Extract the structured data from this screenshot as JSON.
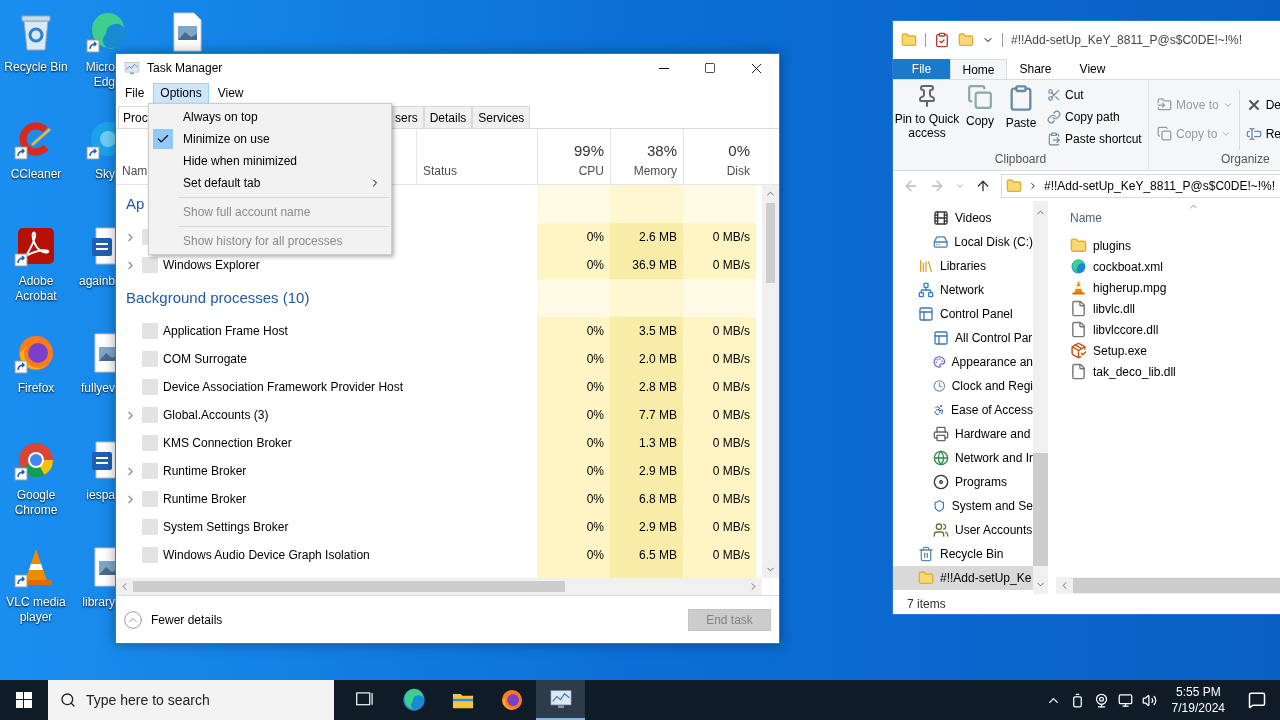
{
  "desktop": {
    "columns": [
      [
        {
          "kind": "recycle",
          "label": "Recycle Bin",
          "shortcut": false
        },
        {
          "kind": "ccleaner",
          "label": "CCleaner",
          "shortcut": true
        },
        {
          "kind": "acrobat",
          "label": "Adobe Acrobat",
          "shortcut": true
        },
        {
          "kind": "firefox",
          "label": "Firefox",
          "shortcut": true
        },
        {
          "kind": "chrome",
          "label": "Google Chrome",
          "shortcut": true
        },
        {
          "kind": "vlc",
          "label": "VLC media player",
          "shortcut": true
        }
      ],
      [
        {
          "kind": "edge",
          "label": "Micro Edg",
          "shortcut": true
        },
        {
          "kind": "skype",
          "label": "Sky",
          "shortcut": true
        },
        {
          "kind": "word",
          "label": "againb",
          "shortcut": false
        },
        {
          "kind": "image",
          "label": "fullyev",
          "shortcut": false
        },
        {
          "kind": "word",
          "label": "iespa",
          "shortcut": false
        },
        {
          "kind": "image",
          "label": "library",
          "shortcut": false
        }
      ],
      [
        {
          "kind": "image",
          "shortcut": false
        }
      ]
    ]
  },
  "task_manager": {
    "title": "Task Manager",
    "menus": [
      {
        "label": "File",
        "selected": false
      },
      {
        "label": "Options",
        "selected": true
      },
      {
        "label": "View",
        "selected": false
      }
    ],
    "options_menu": [
      {
        "kind": "item",
        "label": "Always on top",
        "checked": false,
        "disabled": false
      },
      {
        "kind": "item",
        "label": "Minimize on use",
        "checked": true,
        "disabled": false
      },
      {
        "kind": "item",
        "label": "Hide when minimized",
        "checked": false,
        "disabled": false
      },
      {
        "kind": "submenu",
        "label": "Set default tab",
        "checked": false,
        "disabled": false
      },
      {
        "kind": "separator"
      },
      {
        "kind": "item",
        "label": "Show full account name",
        "checked": false,
        "disabled": true
      },
      {
        "kind": "separator"
      },
      {
        "kind": "item",
        "label": "Show history for all processes",
        "checked": false,
        "disabled": true
      }
    ],
    "tabs": [
      {
        "label": "Proc",
        "selected": true
      },
      {
        "label": "sers",
        "selected": false
      },
      {
        "label": "Details",
        "selected": false
      },
      {
        "label": "Services",
        "selected": false
      }
    ],
    "columns": {
      "name": "Nam",
      "status": "Status",
      "cpu": {
        "percent": "99%",
        "label": "CPU"
      },
      "memory": {
        "percent": "38%",
        "label": "Memory"
      },
      "disk": {
        "percent": "0%",
        "label": "Disk"
      }
    },
    "sections": [
      {
        "title": "Ap",
        "rows": [
          {
            "expandable": true,
            "cpu": "0%",
            "memory": "2.6 MB",
            "disk": "0 MB/s"
          },
          {
            "name": "Windows Explorer",
            "expandable": true,
            "cpu": "0%",
            "memory": "36.9 MB",
            "disk": "0 MB/s"
          }
        ]
      },
      {
        "title": "Background processes (10)",
        "rows": [
          {
            "name": "Application Frame Host",
            "expandable": false,
            "cpu": "0%",
            "memory": "3.5 MB",
            "disk": "0 MB/s"
          },
          {
            "name": "COM Surrogate",
            "expandable": false,
            "cpu": "0%",
            "memory": "2.0 MB",
            "disk": "0 MB/s"
          },
          {
            "name": "Device Association Framework Provider Host",
            "expandable": false,
            "cpu": "0%",
            "memory": "2.8 MB",
            "disk": "0 MB/s"
          },
          {
            "name": "Global.Accounts (3)",
            "expandable": true,
            "cpu": "0%",
            "memory": "7.7 MB",
            "disk": "0 MB/s"
          },
          {
            "name": "KMS Connection Broker",
            "expandable": false,
            "cpu": "0%",
            "memory": "1.3 MB",
            "disk": "0 MB/s"
          },
          {
            "name": "Runtime Broker",
            "expandable": true,
            "cpu": "0%",
            "memory": "2.9 MB",
            "disk": "0 MB/s"
          },
          {
            "name": "Runtime Broker",
            "expandable": true,
            "cpu": "0%",
            "memory": "6.8 MB",
            "disk": "0 MB/s"
          },
          {
            "name": "System Settings Broker",
            "expandable": false,
            "cpu": "0%",
            "memory": "2.9 MB",
            "disk": "0 MB/s"
          },
          {
            "name": "Windows Audio Device Graph Isolation",
            "expandable": false,
            "cpu": "0%",
            "memory": "6.5 MB",
            "disk": "0 MB/s"
          }
        ]
      }
    ],
    "footer": {
      "toggle": "Fewer details",
      "end_task": {
        "label": "End task",
        "disabled": true
      }
    }
  },
  "explorer": {
    "title": "#!!Add-setUp_KeY_8811_P@s$C0DE!~!%!",
    "ribbon_tabs": [
      {
        "label": "File",
        "kind": "file",
        "selected": false
      },
      {
        "label": "Home",
        "kind": "tab",
        "selected": true
      },
      {
        "label": "Share",
        "kind": "tab",
        "selected": false
      },
      {
        "label": "View",
        "kind": "tab",
        "selected": false
      }
    ],
    "clipboard": {
      "pin": "Pin to Quick access",
      "copy": "Copy",
      "paste": "Paste",
      "cut": "Cut",
      "copy_path": "Copy path",
      "paste_shortcut": "Paste shortcut",
      "label": "Clipboard"
    },
    "organize": {
      "move_to": {
        "label": "Move to",
        "disabled": true
      },
      "copy_to": {
        "label": "Copy to",
        "disabled": true
      },
      "delete": "De",
      "rename": "Re",
      "label": "Organize"
    },
    "back": {
      "disabled": true
    },
    "forward": {
      "disabled": true
    },
    "path": "#!!Add-setUp_KeY_8811_P@s$C0DE!~!%!",
    "nav_pane": {
      "continued_children": [
        {
          "label": "Videos",
          "kind": "videos",
          "selected": false
        },
        {
          "label": "Local Disk (C:)",
          "kind": "disk",
          "selected": false
        }
      ],
      "items": [
        {
          "label": "Libraries",
          "kind": "libraries",
          "selected": false
        },
        {
          "label": "Network",
          "kind": "network",
          "selected": false
        },
        {
          "label": "Control Panel",
          "kind": "control",
          "selected": false,
          "children": [
            {
              "label": "All Control Par",
              "kind": "control",
              "selected": false
            },
            {
              "label": "Appearance an",
              "kind": "appearance",
              "selected": false
            },
            {
              "label": "Clock and Regi",
              "kind": "clock",
              "selected": false
            },
            {
              "label": "Ease of Access",
              "kind": "access",
              "selected": false
            },
            {
              "label": "Hardware and",
              "kind": "hardware",
              "selected": false
            },
            {
              "label": "Network and Ir",
              "kind": "internet",
              "selected": false
            },
            {
              "label": "Programs",
              "kind": "programs",
              "selected": false
            },
            {
              "label": "System and Se",
              "kind": "system",
              "selected": false
            },
            {
              "label": "User Accounts",
              "kind": "users",
              "selected": false
            }
          ]
        },
        {
          "label": "Recycle Bin",
          "kind": "recycle",
          "selected": false
        },
        {
          "label": "#!!Add-setUp_Ke",
          "kind": "folder",
          "selected": true
        }
      ]
    },
    "column_header": "Name",
    "files": [
      {
        "name": "plugins",
        "kind": "folder"
      },
      {
        "name": "cockboat.xml",
        "kind": "edge"
      },
      {
        "name": "higherup.mpg",
        "kind": "vlc"
      },
      {
        "name": "libvlc.dll",
        "kind": "dll"
      },
      {
        "name": "libvlccore.dll",
        "kind": "dll"
      },
      {
        "name": "Setup.exe",
        "kind": "setup"
      },
      {
        "name": "tak_deco_lib.dll",
        "kind": "dll"
      }
    ],
    "status": "7 items"
  },
  "taskbar": {
    "search_placeholder": "Type here to search",
    "apps": [
      {
        "kind": "taskview",
        "active": false
      },
      {
        "kind": "edge",
        "active": false
      },
      {
        "kind": "explorer",
        "active": false
      },
      {
        "kind": "firefox",
        "active": false
      },
      {
        "kind": "taskmanager",
        "active": true
      }
    ],
    "time": "5:55 PM",
    "date": "7/19/2024"
  }
}
